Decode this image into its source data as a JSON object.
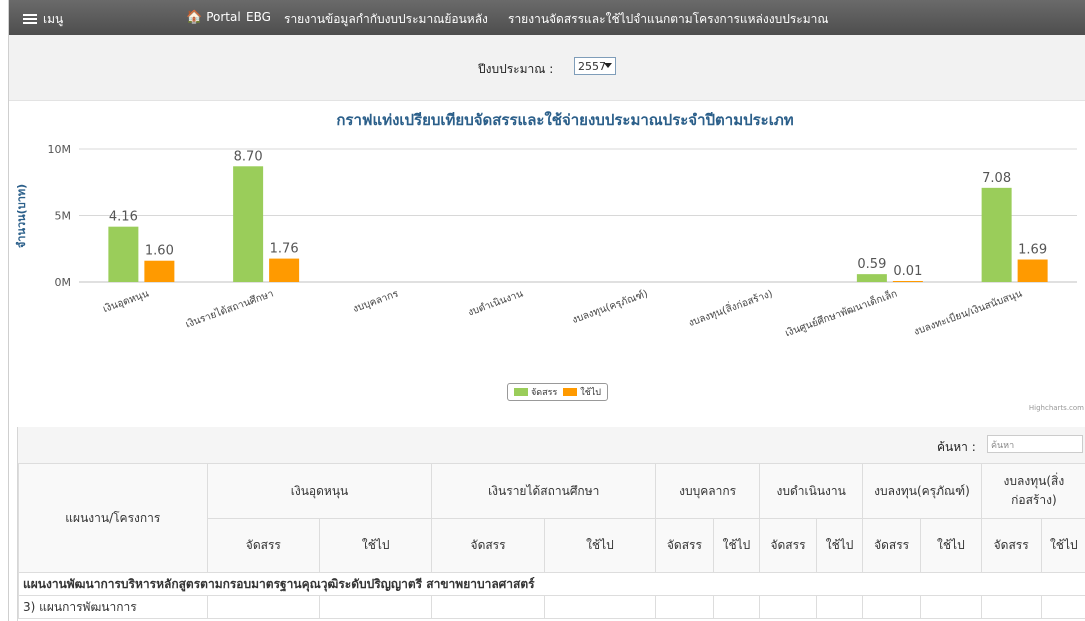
{
  "nav": {
    "menu_label": "เมนู",
    "portal_label": "Portal",
    "ebg_label": "EBG",
    "report1_label": "รายงานข้อมูลกำกับงบประมาณย้อนหลัง",
    "report2_label": "รายงานจัดสรรและใช้ไปจำแนกตามโครงการแหล่งงบประมาณ"
  },
  "year_filter": {
    "label": "ปีงบประมาณ :",
    "selected": "2557"
  },
  "colors": {
    "allocated": "#9acd5a",
    "spent": "#ff9a00",
    "title": "#2b5f8a"
  },
  "chart_data": {
    "type": "bar",
    "title": "กราฟแท่งเปรียบเทียบจัดสรรและใช้จ่ายงบประมาณประจำปีตามประเภท",
    "ylabel": "จำนวน(บาท)",
    "ylim": [
      0,
      10000000
    ],
    "yticks": [
      "0M",
      "5M",
      "10M"
    ],
    "grid": true,
    "legend_placement": "bottom-center",
    "categories": [
      "เงินอุดหนุน",
      "เงินรายได้สถานศึกษา",
      "งบบุคลากร",
      "งบดำเนินงาน",
      "งบลงทุน(ครุภัณฑ์)",
      "งบลงทุน(สิ่งก่อสร้าง)",
      "เงินศูนย์ศึกษาพัฒนาเด็กเล็ก",
      "งบลงทะเบียน/เงินสนับสนุน"
    ],
    "series": [
      {
        "name": "จัดสรร",
        "values": [
          4.16,
          8.7,
          null,
          null,
          null,
          null,
          0.59,
          7.08
        ],
        "labels": [
          "4.16",
          "8.70",
          "",
          "",
          "",
          "",
          "0.59",
          "7.08"
        ]
      },
      {
        "name": "ใช้ไป",
        "values": [
          1.6,
          1.76,
          null,
          null,
          null,
          null,
          0.01,
          1.69
        ],
        "labels": [
          "1.60",
          "1.76",
          "",
          "",
          "",
          "",
          "0.01",
          "1.69"
        ]
      }
    ],
    "credit": "Highcharts.com"
  },
  "table": {
    "search_label": "ค้นหา :",
    "search_placeholder": "ค้นหา",
    "plan_header": "แผนงาน/โครงการ",
    "groups": [
      "เงินอุดหนุน",
      "เงินรายได้สถานศึกษา",
      "งบบุคลากร",
      "งบดำเนินงาน",
      "งบลงทุน(ครุภัณฑ์)",
      "งบลงทุน(สิ่งก่อสร้าง)"
    ],
    "allocated_label": "จัดสรร",
    "spent_label": "ใช้ไป",
    "section_title": "แผนงานพัฒนาการบริหารหลักสูตรตามกรอบมาตรฐานคุณวุฒิระดับปริญญาตรี สาขาพยาบาลศาสตร์",
    "first_plan": "3) แผนการพัฒนาการ"
  }
}
